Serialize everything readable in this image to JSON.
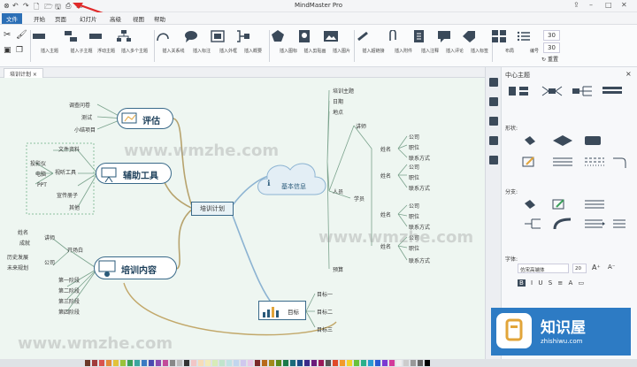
{
  "app": {
    "title": "MindMaster Pro"
  },
  "menu": {
    "file": "文件",
    "items": [
      "开始",
      "页面",
      "幻灯片",
      "高级",
      "视图",
      "帮助"
    ]
  },
  "ribbon": {
    "buttons": [
      "插入主题",
      "插入子主题",
      "浮动主题",
      "插入多个主题",
      "插入关系线",
      "插入标注",
      "插入外框",
      "插入概要",
      "插入图标",
      "插入剪贴画",
      "插入图片",
      "插入超链接",
      "插入附件",
      "插入注释",
      "插入评论",
      "插入标签",
      "布局",
      "编号"
    ]
  },
  "ribbon_right": {
    "val1": "30",
    "val2": "30",
    "reset": "重置"
  },
  "doc_tab": "培训计划",
  "sidebar": {
    "title": "中心主题",
    "sec_shape": "形状:",
    "sec_branch": "分支:",
    "sec_font": "字体:",
    "font_name": "仿宋高端体",
    "font_size": "20"
  },
  "mindmap": {
    "center": "培训计划",
    "eval": {
      "title": "评估",
      "items": [
        "调查问卷",
        "测试",
        "小结项目"
      ]
    },
    "tools": {
      "title": "辅助工具",
      "left": [
        "投影仪",
        "电脑",
        "PPT"
      ],
      "mid": [
        "文件资料",
        "视听工具",
        "宣传册子",
        "其他"
      ]
    },
    "content": {
      "title": "培训内容",
      "top": [
        "开场白"
      ],
      "top_sub": [
        "讲师",
        "公司"
      ],
      "top_leaf": [
        "姓名",
        "成就",
        "历史发展",
        "未来规划"
      ],
      "stages": [
        "第一阶段",
        "第二阶段",
        "第三阶段",
        "第四阶段"
      ]
    },
    "cloud": {
      "title": "基本信息",
      "items": [
        "培训主题",
        "日期",
        "地点",
        "人员",
        "预算"
      ]
    },
    "people": {
      "trainer": "讲师",
      "trainee": "学员",
      "names": [
        "姓名",
        "姓名",
        "姓名",
        "姓名"
      ],
      "fields": [
        "公司",
        "职位",
        "联系方式"
      ]
    },
    "goal": {
      "title": "目标",
      "items": [
        "目标一",
        "目标二",
        "目标三"
      ]
    }
  },
  "watermark": "www.wmzhe.com",
  "logo": {
    "cn": "知识屋",
    "en": "zhishiwu.com"
  }
}
